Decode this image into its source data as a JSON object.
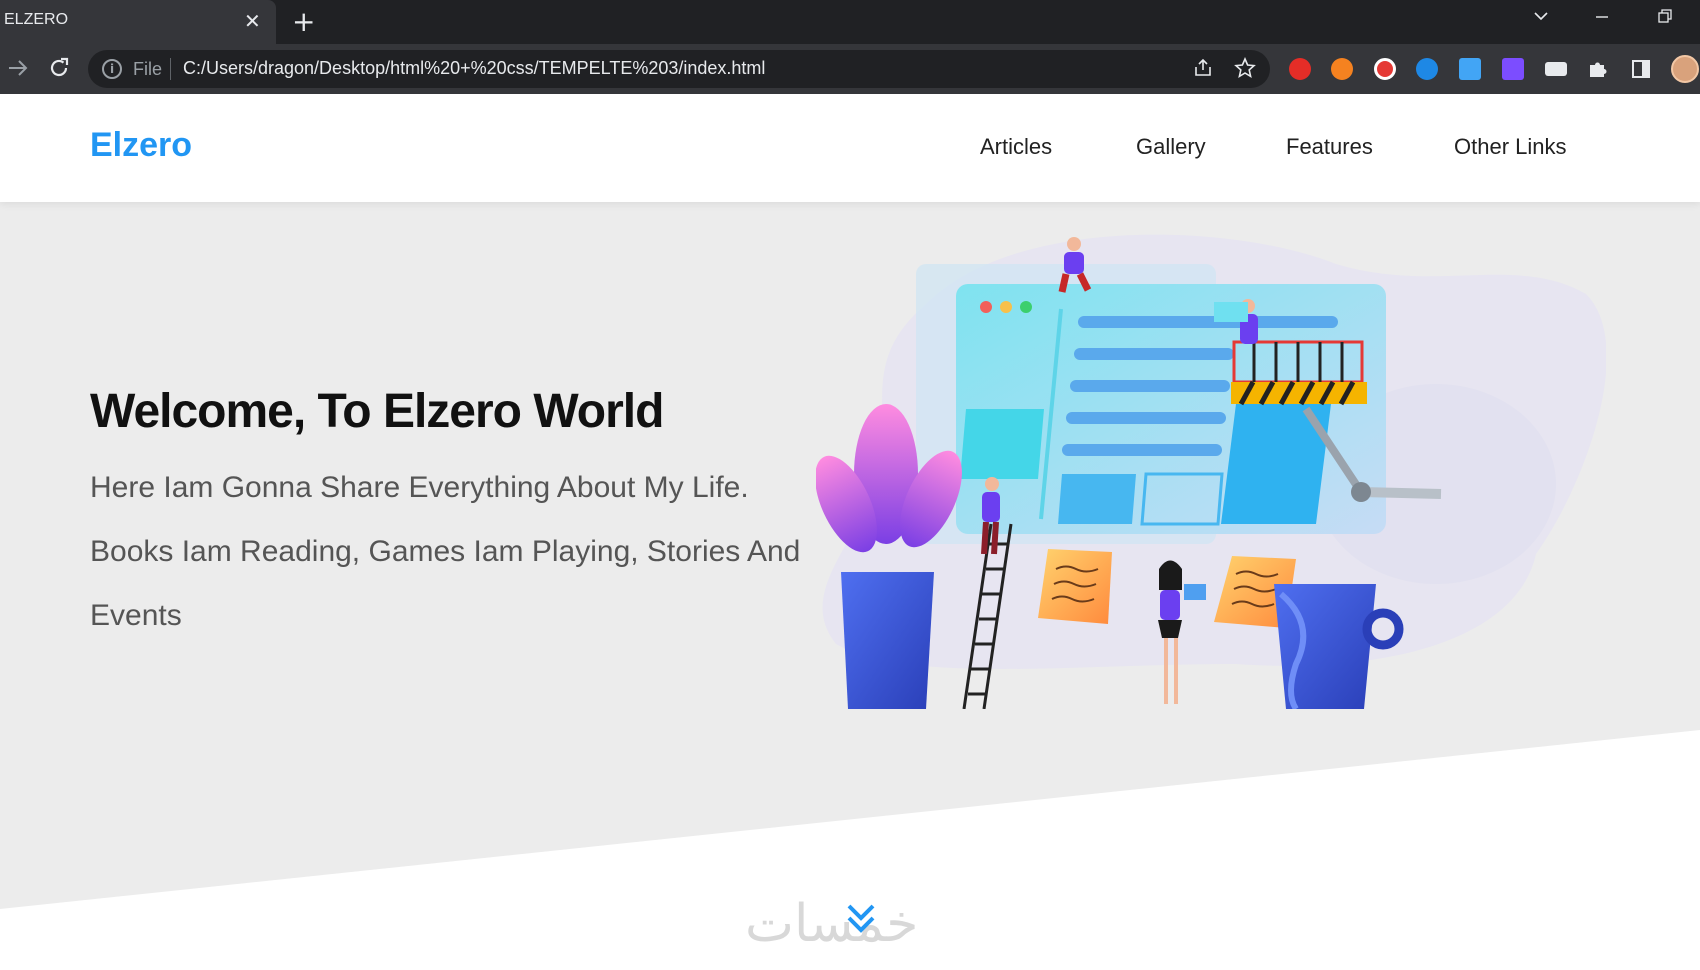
{
  "browser": {
    "tab_title": "ELZERO",
    "tab_close": "✕",
    "new_tab": "+",
    "scheme": "File",
    "url": "C:/Users/dragon/Desktop/html%20+%20css/TEMPELTE%203/index.html",
    "window_controls": [
      "chevron-down-icon",
      "minimize-icon",
      "restore-icon"
    ]
  },
  "site": {
    "logo": "Elzero",
    "nav": [
      "Articles",
      "Gallery",
      "Features",
      "Other Links"
    ],
    "hero": {
      "title": "Welcome, To Elzero World",
      "description": "Here Iam Gonna Share Everything About My Life. Books Iam Reading, Games Iam Playing, Stories And Events"
    },
    "go_down_icon": "double-chevron-down-icon",
    "watermark": "خمسات"
  },
  "colors": {
    "brand": "#2196f3",
    "hero_bg": "#ececec",
    "chrome_dark": "#202124",
    "chrome_mid": "#35363a"
  }
}
